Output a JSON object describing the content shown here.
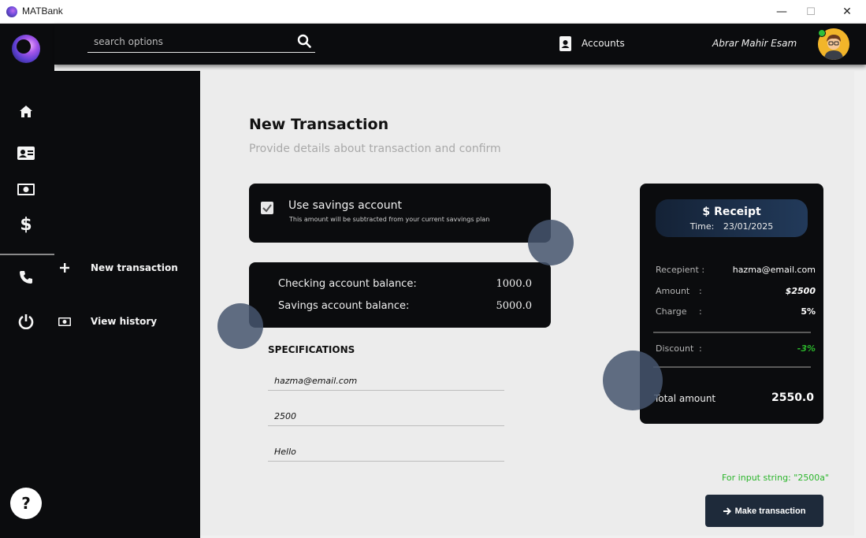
{
  "window": {
    "title": "MATBank",
    "minimize_glyph": "—",
    "maximize_glyph": "☐",
    "close_glyph": "✕"
  },
  "header": {
    "search_placeholder": "search options",
    "accounts_label": "Accounts",
    "user_name": "Abrar Mahir Esam"
  },
  "rail": {
    "icons": [
      "home-icon",
      "contact-card-icon",
      "banknote-icon",
      "dollar-icon",
      "phone-icon",
      "power-icon"
    ],
    "help_label": "?"
  },
  "submenu": {
    "items": [
      {
        "label": "New transaction",
        "icon": "plus-icon"
      },
      {
        "label": "View history",
        "icon": "banknote-icon"
      }
    ]
  },
  "main": {
    "title": "New Transaction",
    "subtitle": "Provide details about transaction and confirm",
    "savings": {
      "checked": true,
      "title": "Use savings account",
      "note": "This amount will be subtracted from your current savvings plan"
    },
    "balances": {
      "checking_label": "Checking account balance:",
      "checking_value": "1000.0",
      "savings_label": "Savings account balance:",
      "savings_value": "5000.0"
    },
    "specifications": {
      "title": "SPECIFICATIONS",
      "recipient_value": "hazma@email.com",
      "amount_value": "2500",
      "note_value": "Hello"
    },
    "status_message": "For input string: \"2500a\"",
    "make_transaction_label": "Make transaction"
  },
  "receipt": {
    "title": "Receipt",
    "time_label": "Time:",
    "time_value": "23/01/2025",
    "recipient_label": "Recepient :",
    "recipient_value": "hazma@email.com",
    "amount_label": "Amount",
    "amount_value": "$2500",
    "charge_label": "Charge",
    "charge_value": "5%",
    "discount_label": "Discount",
    "discount_value": "-3%",
    "colon": ":",
    "total_label": "Total amount",
    "total_value": "2550.0"
  },
  "colors": {
    "dark": "#0b0c0e",
    "accent_navy": "#1e2a3a",
    "success_green": "#2bb52b",
    "bubble": "#46566e"
  }
}
